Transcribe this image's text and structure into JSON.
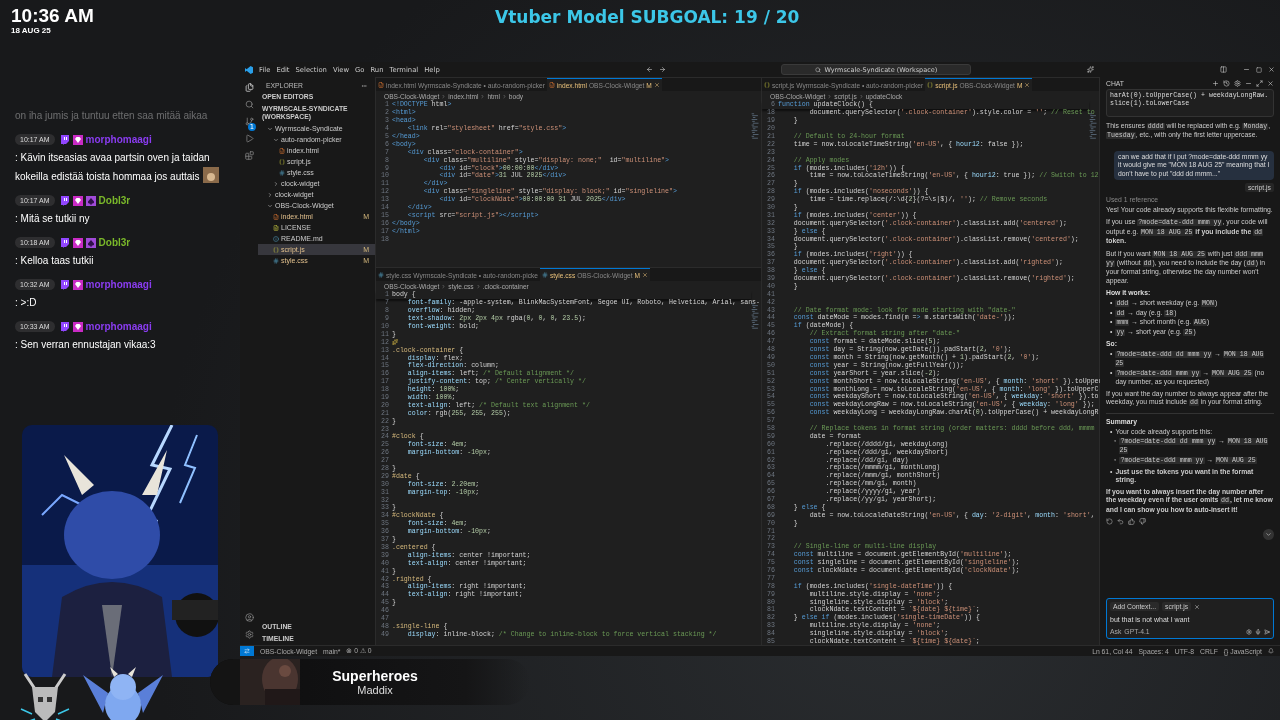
{
  "clock": {
    "time": "10:36 AM",
    "date": "18 AUG 25"
  },
  "subgoal": "Vtuber Model SUBGOAL: 19 / 20",
  "stream_chat": [
    {
      "text": "on iha jumis ja tuntuu etten saa mitää aikaa",
      "faded": true,
      "emote": false
    },
    {
      "time": "10:17 AM",
      "user": "morphomaagi",
      "color": "#8a3cf0",
      "badges": [
        {
          "kind": "platform",
          "color": "#9146ff"
        },
        {
          "kind": "gem",
          "color": "#c92bc5"
        }
      ],
      "text": ": Kävin itseasias avaa partsin oven ja taidan kokeilla edistää toista hommaa jos auttais",
      "faded": false,
      "emote": true
    },
    {
      "time": "10:17 AM",
      "user": "Dobl3r",
      "color": "#7ab82a",
      "badges": [
        {
          "kind": "platform",
          "color": "#9146ff"
        },
        {
          "kind": "gem",
          "color": "#c92bc5"
        },
        {
          "kind": "spade",
          "color": "#a04ad8"
        }
      ],
      "text": ": Mitä se tutkii ny",
      "faded": false,
      "emote": false
    },
    {
      "time": "10:18 AM",
      "user": "Dobl3r",
      "color": "#7ab82a",
      "badges": [
        {
          "kind": "platform",
          "color": "#9146ff"
        },
        {
          "kind": "gem",
          "color": "#c92bc5"
        },
        {
          "kind": "spade",
          "color": "#a04ad8"
        }
      ],
      "text": ": Kelloa taas tutkii",
      "faded": false,
      "emote": false
    },
    {
      "time": "10:32 AM",
      "user": "morphomaagi",
      "color": "#8a3cf0",
      "badges": [
        {
          "kind": "platform",
          "color": "#9146ff"
        },
        {
          "kind": "gem",
          "color": "#c92bc5"
        }
      ],
      "text": ": >:D",
      "faded": false,
      "emote": false
    },
    {
      "time": "10:33 AM",
      "user": "morphomaagi",
      "color": "#8a3cf0",
      "badges": [
        {
          "kind": "platform",
          "color": "#9146ff"
        },
        {
          "kind": "gem",
          "color": "#c92bc5"
        }
      ],
      "text": ": Sen verran ennustajan vikaa:3",
      "faded": false,
      "emote": false
    }
  ],
  "now_playing": {
    "title": "Superheroes",
    "artist": "Maddix"
  },
  "vscode": {
    "menu": [
      "File",
      "Edit",
      "Selection",
      "View",
      "Go",
      "Run",
      "Terminal",
      "Help"
    ],
    "search": "Wyrmscale-Syndicate (Workspace)",
    "scm_badge": "1",
    "explorer": {
      "title": "EXPLORER",
      "sections": [
        "OPEN EDITORS",
        "WYRMSCALE-SYNDICATE (WORKSPACE)"
      ],
      "bottom_sections": [
        "OUTLINE",
        "TIMELINE"
      ],
      "tree": [
        {
          "label": "Wyrmscale-Syndicate",
          "kind": "folder",
          "expanded": true,
          "selected": false,
          "children": [
            {
              "label": "auto-random-picker",
              "kind": "folder",
              "expanded": true,
              "selected": false,
              "children": [
                {
                  "label": "index.html",
                  "kind": "html",
                  "selected": false
                },
                {
                  "label": "script.js",
                  "kind": "js",
                  "selected": false
                },
                {
                  "label": "style.css",
                  "kind": "css",
                  "selected": false
                }
              ]
            },
            {
              "label": "clock-widget",
              "kind": "folder",
              "expanded": false,
              "selected": false
            }
          ]
        },
        {
          "label": "clock-widget",
          "kind": "folder",
          "expanded": false,
          "selected": false
        },
        {
          "label": "OBS-Clock-Widget",
          "kind": "folder",
          "expanded": true,
          "selected": false,
          "children": [
            {
              "label": "index.html",
              "kind": "html",
              "selected": false,
              "badge": "M"
            },
            {
              "label": "LICENSE",
              "kind": "license",
              "selected": false
            },
            {
              "label": "README.md",
              "kind": "md",
              "selected": false
            },
            {
              "label": "script.js",
              "kind": "js",
              "selected": true,
              "badge": "M"
            },
            {
              "label": "style.css",
              "kind": "css",
              "selected": false,
              "badge": "M"
            }
          ]
        }
      ]
    },
    "left_panes": [
      {
        "tabs": [
          {
            "name": "index.html",
            "kind": "html",
            "detail": "Wyrmscale-Syndicate • auto-random-picker",
            "selected": false
          },
          {
            "name": "index.html",
            "kind": "html",
            "detail": "OBS-Clock-Widget",
            "badge": "M",
            "selected": true
          }
        ],
        "breadcrumb": [
          "OBS-Clock-Widget",
          "index.html",
          "html",
          "body"
        ],
        "lines": [
          {
            "n": "1",
            "text": "<!DOCTYPE html>"
          },
          {
            "n": "2",
            "text": "<html>"
          },
          {
            "n": "3",
            "text": "<head>"
          },
          {
            "n": "4",
            "text": "    <link rel=\"stylesheet\" href=\"style.css\">"
          },
          {
            "n": "5",
            "text": "</head>"
          },
          {
            "n": "6",
            "text": "<body>"
          },
          {
            "n": "7",
            "text": "    <div class=\"clock-container\">"
          },
          {
            "n": "8",
            "text": "        <div class=\"multiline\" style=\"display: none;\"  id=\"multiline\">"
          },
          {
            "n": "9",
            "text": "            <div id=\"clock\">00:00:00</div>"
          },
          {
            "n": "10",
            "text": "            <div id=\"date\">31 JUL 2025</div>"
          },
          {
            "n": "11",
            "text": "        </div>"
          },
          {
            "n": "12",
            "text": "        <div class=\"singleline\" style=\"display: block;\" id=\"singleline\">"
          },
          {
            "n": "13",
            "text": "            <div id=\"clockNdate\">00:00:00 31 JUL 2025</div>"
          },
          {
            "n": "14",
            "text": "    </div>"
          },
          {
            "n": "15",
            "text": "    <script src=\"script.js\"></script>"
          },
          {
            "n": "16",
            "text": "</body>"
          },
          {
            "n": "17",
            "text": "</html>"
          },
          {
            "n": "18"
          }
        ]
      },
      {
        "tabs": [
          {
            "name": "style.css",
            "kind": "css",
            "detail": "Wyrmscale-Syndicate • auto-random-picke",
            "selected": false
          },
          {
            "name": "style.css",
            "kind": "css",
            "detail": "OBS-Clock-Widget",
            "badge": "M",
            "selected": true
          }
        ],
        "breadcrumb": [
          "OBS-Clock-Widget",
          "style.css",
          ".clock-container"
        ],
        "sticky": {
          "n": "1",
          "text": "body {"
        },
        "lines": [
          {
            "n": "7",
            "text": "    font-family: -apple-system, BlinkMacSystemFont, Segoe UI, Roboto, Helvetica, Arial, sans-"
          },
          {
            "n": "8",
            "text": "    overflow: hidden;"
          },
          {
            "n": "9",
            "text": "    text-shadow: 2px 2px 4px rgba(0, 0, 0, 23.5);"
          },
          {
            "n": "10",
            "text": "    font-weight: bold;"
          },
          {
            "n": "11",
            "text": "}"
          },
          {
            "n": "12",
            "kind": "bulb"
          },
          {
            "n": "13",
            "text": ".clock-container {"
          },
          {
            "n": "14",
            "text": "    display: flex;"
          },
          {
            "n": "15",
            "text": "    flex-direction: column;"
          },
          {
            "n": "16",
            "text": "    align-items: left; /* Default alignment */"
          },
          {
            "n": "17",
            "text": "    justify-content: top; /* Center vertically */"
          },
          {
            "n": "18",
            "text": "    height: 100%;"
          },
          {
            "n": "19",
            "text": "    width: 100%;"
          },
          {
            "n": "20",
            "text": "    text-align: left; /* Default text alignment */"
          },
          {
            "n": "21",
            "text": "    color: rgb(255, 255, 255);"
          },
          {
            "n": "22",
            "text": "}"
          },
          {
            "n": "23"
          },
          {
            "n": "24",
            "text": "#clock {"
          },
          {
            "n": "25",
            "text": "    font-size: 4em;"
          },
          {
            "n": "26",
            "text": "    margin-bottom: -10px;"
          },
          {
            "n": "27"
          },
          {
            "n": "28",
            "text": "}"
          },
          {
            "n": "29",
            "text": "#date {"
          },
          {
            "n": "30",
            "text": "    font-size: 2.20em;"
          },
          {
            "n": "31",
            "text": "    margin-top: -10px;"
          },
          {
            "n": "32"
          },
          {
            "n": "33",
            "text": "}"
          },
          {
            "n": "34",
            "text": "#clockNdate {"
          },
          {
            "n": "35",
            "text": "    font-size: 4em;"
          },
          {
            "n": "36",
            "text": "    margin-bottom: -10px;"
          },
          {
            "n": "37",
            "text": "}"
          },
          {
            "n": "38",
            "text": ".centered {"
          },
          {
            "n": "39",
            "text": "    align-items: center !important;"
          },
          {
            "n": "40",
            "text": "    text-align: center !important;"
          },
          {
            "n": "41",
            "text": "}"
          },
          {
            "n": "42",
            "text": ".righted {"
          },
          {
            "n": "43",
            "text": "    align-items: right !important;"
          },
          {
            "n": "44",
            "text": "    text-align: right !important;"
          },
          {
            "n": "45",
            "text": "}"
          },
          {
            "n": "46"
          },
          {
            "n": "47"
          },
          {
            "n": "48",
            "text": ".single-line {"
          },
          {
            "n": "49",
            "text": "    display: inline-block; /* Change to inline-block to force vertical stacking */"
          }
        ]
      }
    ],
    "right_pane": {
      "tabs": [
        {
          "name": "script.js",
          "kind": "js",
          "detail": "Wyrmscale-Syndicate • auto-random-picker",
          "selected": false
        },
        {
          "name": "script.js",
          "kind": "js",
          "detail": "OBS-Clock-Widget",
          "badge": "M",
          "selected": true
        }
      ],
      "breadcrumb": [
        "OBS-Clock-Widget",
        "script.js",
        "updateClock"
      ],
      "sticky": {
        "n": "6",
        "text": "function updateClock() {"
      },
      "lines": [
        {
          "n": "18",
          "text": "        document.querySelector('.clock-container').style.color = ''; // Reset to"
        },
        {
          "n": "19",
          "text": "    }"
        },
        {
          "n": "20"
        },
        {
          "n": "21",
          "text": "    // Default to 24-hour format"
        },
        {
          "n": "22",
          "text": "    time = now.toLocaleTimeString('en-US', { hour12: false });"
        },
        {
          "n": "23"
        },
        {
          "n": "24",
          "text": "    // Apply modes"
        },
        {
          "n": "25",
          "text": "    if (modes.includes('12h')) {"
        },
        {
          "n": "26",
          "text": "        time = now.toLocaleTimeString('en-US', { hour12: true }); // Switch to 12"
        },
        {
          "n": "27",
          "text": "    }"
        },
        {
          "n": "28",
          "text": "    if (modes.includes('noseconds')) {"
        },
        {
          "n": "29",
          "text": "        time = time.replace(/:\\d{2}(?=\\s|$)/, ''); // Remove seconds"
        },
        {
          "n": "30",
          "text": "    }"
        },
        {
          "n": "31",
          "text": "    if (modes.includes('center')) {"
        },
        {
          "n": "32",
          "text": "    document.querySelector('.clock-container').classList.add('centered');"
        },
        {
          "n": "33",
          "text": "    } else {"
        },
        {
          "n": "34",
          "text": "    document.querySelector('.clock-container').classList.remove('centered');"
        },
        {
          "n": "35",
          "text": "    }"
        },
        {
          "n": "36",
          "text": "    if (modes.includes('right')) {"
        },
        {
          "n": "37",
          "text": "    document.querySelector('.clock-container').classList.add('righted');"
        },
        {
          "n": "38",
          "text": "    } else {"
        },
        {
          "n": "39",
          "text": "    document.querySelector('.clock-container').classList.remove('righted');"
        },
        {
          "n": "40",
          "text": "    }"
        },
        {
          "n": "41"
        },
        {
          "n": "42"
        },
        {
          "n": "43",
          "text": "    // Date format mode: look for mode starting with \"date-\""
        },
        {
          "n": "44",
          "text": "    const dateMode = modes.find(m => m.startsWith('date-'));"
        },
        {
          "n": "45",
          "text": "    if (dateMode) {"
        },
        {
          "n": "46",
          "text": "        // Extract format string after \"date-\""
        },
        {
          "n": "47",
          "text": "        const format = dateMode.slice(5);"
        },
        {
          "n": "48",
          "text": "        const day = String(now.getDate()).padStart(2, '0');"
        },
        {
          "n": "49",
          "text": "        const month = String(now.getMonth() + 1).padStart(2, '0');"
        },
        {
          "n": "50",
          "text": "        const year = String(now.getFullYear());"
        },
        {
          "n": "51",
          "text": "        const yearShort = year.slice(-2);"
        },
        {
          "n": "52",
          "text": "        const monthShort = now.toLocaleString('en-US', { month: 'short' }).toUpper"
        },
        {
          "n": "53",
          "text": "        const monthLong = now.toLocaleString('en-US', { month: 'long' }).toUpperC"
        },
        {
          "n": "54",
          "text": "        const weekdayShort = now.toLocaleString('en-US', { weekday: 'short' }).to"
        },
        {
          "n": "55",
          "text": "        const weekdayLongRaw = now.toLocaleString('en-US', { weekday: 'long' });"
        },
        {
          "n": "56",
          "text": "        const weekdayLong = weekdayLongRaw.charAt(0).toUpperCase() + weekdayLongR"
        },
        {
          "n": "57"
        },
        {
          "n": "58",
          "text": "        // Replace tokens in format string (order matters: dddd before ddd, mmmm"
        },
        {
          "n": "59",
          "text": "        date = format"
        },
        {
          "n": "60",
          "text": "            .replace(/dddd/gi, weekdayLong)"
        },
        {
          "n": "61",
          "text": "            .replace(/ddd/gi, weekdayShort)"
        },
        {
          "n": "62",
          "text": "            .replace(/dd/gi, day)"
        },
        {
          "n": "63",
          "text": "            .replace(/mmmm/gi, monthLong)"
        },
        {
          "n": "64",
          "text": "            .replace(/mmm/gi, monthShort)"
        },
        {
          "n": "65",
          "text": "            .replace(/mm/gi, month)"
        },
        {
          "n": "66",
          "text": "            .replace(/yyyy/gi, year)"
        },
        {
          "n": "67",
          "text": "            .replace(/yy/gi, yearShort);"
        },
        {
          "n": "68",
          "text": "    } else {"
        },
        {
          "n": "69",
          "text": "        date = now.toLocaleDateString('en-US', { day: '2-digit', month: 'short',"
        },
        {
          "n": "70",
          "text": "    }"
        },
        {
          "n": "71"
        },
        {
          "n": "72"
        },
        {
          "n": "73",
          "text": "    // Single-line or multi-line display"
        },
        {
          "n": "74",
          "text": "    const multiline = document.getElementById('multiline');"
        },
        {
          "n": "75",
          "text": "    const singleline = document.getElementById('singleline');"
        },
        {
          "n": "76",
          "text": "    const clockNdate = document.getElementById('clockNdate');"
        },
        {
          "n": "77"
        },
        {
          "n": "78",
          "text": "    if (modes.includes('single-dateTime')) {"
        },
        {
          "n": "79",
          "text": "        multiline.style.display = 'none';"
        },
        {
          "n": "80",
          "text": "        singleline.style.display = 'block';"
        },
        {
          "n": "81",
          "text": "        clockNdate.textContent = `${date} ${time}`;"
        },
        {
          "n": "82",
          "text": "    } else if (modes.includes('single-timeDate')) {"
        },
        {
          "n": "83",
          "text": "        multiline.style.display = 'none';"
        },
        {
          "n": "84",
          "text": "        singleline.style.display = 'block';"
        },
        {
          "n": "85",
          "text": "        clockNdate.textContent = `${time} ${date}`;"
        }
      ]
    },
    "chat": {
      "title": "CHAT",
      "blocks": [
        {
          "kind": "codeblock",
          "text": "harAt(0).toUpperCase() + weekdayLongRaw.slice(1).toLowerCase"
        },
        {
          "kind": "para",
          "segments": [
            {
              "kind": "text",
              "text": "This ensures "
            },
            {
              "kind": "code",
              "text": "dddd"
            },
            {
              "kind": "text",
              "text": " will be replaced with e.g. "
            },
            {
              "kind": "code",
              "text": "Monday"
            },
            {
              "kind": "text",
              "text": ", "
            },
            {
              "kind": "code",
              "text": "Tuesday"
            },
            {
              "kind": "text",
              "text": ", etc., with only the first letter uppercase."
            }
          ]
        },
        {
          "kind": "user",
          "text": "can we add that if I put ?mode=date-ddd mmm yy it would give me \"MON 18 AUG 25\" meaning that I don't have to put \"ddd dd mmm...\""
        },
        {
          "kind": "chip",
          "text": "script.js"
        },
        {
          "kind": "reference",
          "text": "Used 1 reference"
        },
        {
          "kind": "para",
          "segments": [
            {
              "kind": "text",
              "text": "Yes! Your code already supports this flexible formatting."
            }
          ]
        },
        {
          "kind": "para",
          "segments": [
            {
              "kind": "text",
              "text": "If you use "
            },
            {
              "kind": "code",
              "text": "?mode=date-ddd mmm yy"
            },
            {
              "kind": "text",
              "text": ", your code will output e.g. "
            },
            {
              "kind": "code",
              "text": "MON 18 AUG 25"
            },
            {
              "kind": "bold",
              "text": " if you include the "
            },
            {
              "kind": "code",
              "text": "dd"
            },
            {
              "kind": "bold",
              "text": " token."
            }
          ]
        },
        {
          "kind": "para",
          "segments": [
            {
              "kind": "text",
              "text": "But if you want "
            },
            {
              "kind": "code",
              "text": "MON 18 AUG 25"
            },
            {
              "kind": "text",
              "text": " with just "
            },
            {
              "kind": "code",
              "text": "ddd mmm yy"
            },
            {
              "kind": "text",
              "text": " (without "
            },
            {
              "kind": "code",
              "text": "dd"
            },
            {
              "kind": "text",
              "text": "), you need to include the day ("
            },
            {
              "kind": "code",
              "text": "dd"
            },
            {
              "kind": "text",
              "text": ") in your format string, otherwise the day number won't appear."
            }
          ]
        },
        {
          "kind": "heading",
          "text": "How it works:"
        },
        {
          "kind": "list",
          "items": [
            {
              "marker": "•",
              "segments": [
                {
                  "kind": "code",
                  "text": "ddd"
                },
                {
                  "kind": "text",
                  "text": " → short weekday (e.g. "
                },
                {
                  "kind": "code",
                  "text": "MON"
                },
                {
                  "kind": "text",
                  "text": ")"
                }
              ]
            },
            {
              "marker": "•",
              "segments": [
                {
                  "kind": "code",
                  "text": "dd"
                },
                {
                  "kind": "text",
                  "text": " → day (e.g. "
                },
                {
                  "kind": "code",
                  "text": "18"
                },
                {
                  "kind": "text",
                  "text": ")"
                }
              ]
            },
            {
              "marker": "•",
              "segments": [
                {
                  "kind": "code",
                  "text": "mmm"
                },
                {
                  "kind": "text",
                  "text": " → short month (e.g. "
                },
                {
                  "kind": "code",
                  "text": "AUG"
                },
                {
                  "kind": "text",
                  "text": ")"
                }
              ]
            },
            {
              "marker": "•",
              "segments": [
                {
                  "kind": "code",
                  "text": "yy"
                },
                {
                  "kind": "text",
                  "text": " → short year (e.g. "
                },
                {
                  "kind": "code",
                  "text": "25"
                },
                {
                  "kind": "text",
                  "text": ")"
                }
              ]
            }
          ]
        },
        {
          "kind": "heading",
          "text": "So:"
        },
        {
          "kind": "list",
          "items": [
            {
              "marker": "•",
              "segments": [
                {
                  "kind": "code",
                  "text": "?mode=date-ddd dd mmm yy"
                },
                {
                  "kind": "text",
                  "text": " → "
                },
                {
                  "kind": "code",
                  "text": "MON 18 AUG 25"
                }
              ]
            },
            {
              "marker": "•",
              "segments": [
                {
                  "kind": "code",
                  "text": "?mode=date-ddd mmm yy"
                },
                {
                  "kind": "text",
                  "text": " → "
                },
                {
                  "kind": "code",
                  "text": "MON AUG 25"
                },
                {
                  "kind": "text",
                  "text": " (no day number, as you requested)"
                }
              ]
            }
          ]
        },
        {
          "kind": "para",
          "segments": [
            {
              "kind": "text",
              "text": "If you want the day number to always appear after the weekday, you must include "
            },
            {
              "kind": "code",
              "text": "dd"
            },
            {
              "kind": "text",
              "text": " in your format string."
            }
          ]
        },
        {
          "kind": "rule"
        },
        {
          "kind": "heading",
          "text": "Summary"
        },
        {
          "kind": "list",
          "items": [
            {
              "marker": "•",
              "segments": [
                {
                  "kind": "text",
                  "text": "Your code already supports this:"
                }
              ],
              "children": [
                {
                  "marker": "◦",
                  "segments": [
                    {
                      "kind": "code",
                      "text": "?mode=date-ddd dd mmm yy"
                    },
                    {
                      "kind": "text",
                      "text": " → "
                    },
                    {
                      "kind": "code",
                      "text": "MON 18 AUG 25"
                    }
                  ]
                },
                {
                  "marker": "◦",
                  "segments": [
                    {
                      "kind": "code",
                      "text": "?mode=date-ddd mmm yy"
                    },
                    {
                      "kind": "text",
                      "text": " → "
                    },
                    {
                      "kind": "code",
                      "text": "MON AUG 25"
                    }
                  ]
                }
              ]
            },
            {
              "marker": "•",
              "segments": [
                {
                  "kind": "bold",
                  "text": "Just use the tokens you want in the format string."
                }
              ]
            }
          ]
        },
        {
          "kind": "para",
          "segments": [
            {
              "kind": "bold",
              "text": "If you want to always insert the day number after the weekday even if the user omits "
            },
            {
              "kind": "code",
              "text": "dd"
            },
            {
              "kind": "bold",
              "text": ", let me know and I can show you how to auto-insert it!"
            }
          ]
        },
        {
          "kind": "actions"
        }
      ],
      "input": {
        "context": "Add Context...",
        "file": "script.js",
        "value": "but that is not what I want",
        "mode": "Ask",
        "model": "GPT-4.1"
      }
    },
    "status": {
      "left": [
        "OBS-Clock-Widget",
        "main*",
        "⊗ 0 ⚠ 0"
      ],
      "right": [
        "Ln 61, Col 44",
        "Spaces: 4",
        "UTF-8",
        "CRLF",
        "{} JavaScript"
      ]
    }
  }
}
